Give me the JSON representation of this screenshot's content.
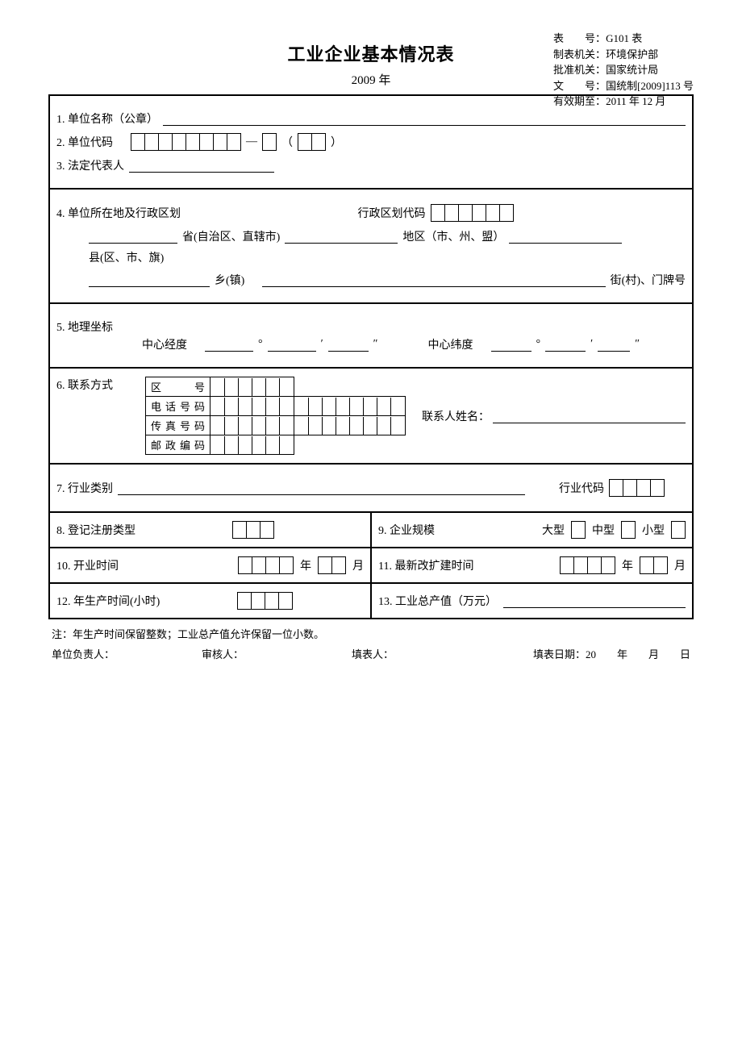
{
  "header": {
    "title": "工业企业基本情况表",
    "year": "2009 年",
    "meta": {
      "form_no_label": "表　　号：",
      "form_no": "G101 表",
      "maker_label": "制表机关：",
      "maker": "环境保护部",
      "approver_label": "批准机关：",
      "approver": "国家统计局",
      "doc_no_label": "文　　号：",
      "doc_no": "国统制[2009]113 号",
      "valid_label": "有效期至：",
      "valid": "2011 年 12 月"
    }
  },
  "s1": {
    "label": "1. 单位名称（公章）"
  },
  "s2": {
    "label": "2. 单位代码"
  },
  "s3": {
    "label": "3. 法定代表人"
  },
  "s4": {
    "label": "4. 单位所在地及行政区划",
    "code_label": "行政区划代码",
    "province": "省(自治区、直辖市)",
    "district": "地区（市、州、盟）",
    "county": "县(区、市、旗)",
    "town": "乡(镇)",
    "street": "街(村)、门牌号"
  },
  "s5": {
    "label": "5. 地理坐标",
    "lon": "中心经度",
    "lat": "中心纬度",
    "deg": "°",
    "min": "′",
    "sec": "″"
  },
  "s6": {
    "label": "6. 联系方式",
    "area": "区　　号",
    "tel": "电话号码",
    "fax": "传真号码",
    "zip": "邮政编码",
    "contact": "联系人姓名："
  },
  "s7": {
    "label": "7. 行业类别",
    "code": "行业代码"
  },
  "s8": {
    "label": "8. 登记注册类型"
  },
  "s9": {
    "label": "9. 企业规模",
    "large": "大型",
    "medium": "中型",
    "small": "小型"
  },
  "s10": {
    "label": "10. 开业时间",
    "y": "年",
    "m": "月"
  },
  "s11": {
    "label": "11. 最新改扩建时间",
    "y": "年",
    "m": "月"
  },
  "s12": {
    "label": "12. 年生产时间(小时)"
  },
  "s13": {
    "label": "13. 工业总产值（万元）"
  },
  "footer": {
    "note": "注：年生产时间保留整数；工业总产值允许保留一位小数。",
    "owner": "单位负责人：",
    "reviewer": "审核人：",
    "filler": "填表人：",
    "date": "填表日期：20　　年　　月　　日"
  }
}
